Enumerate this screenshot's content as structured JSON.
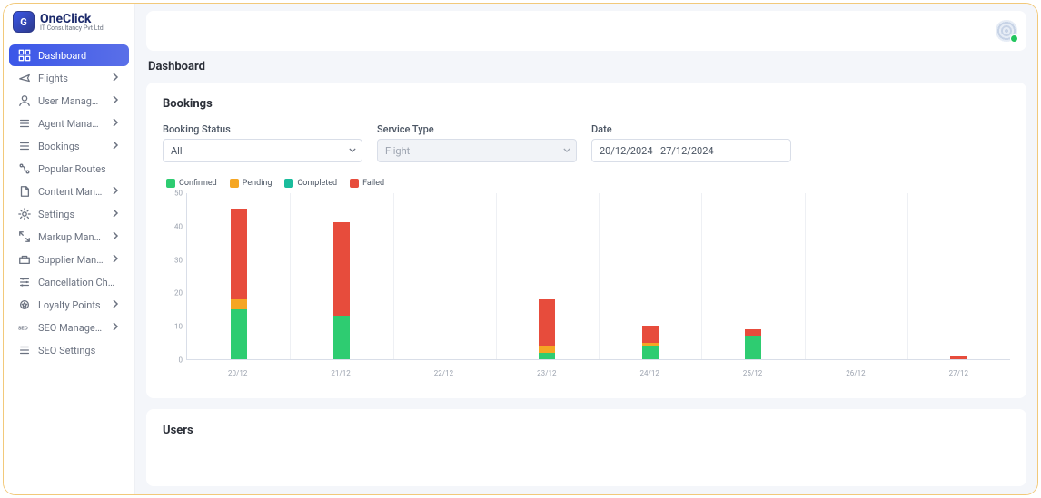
{
  "brand": {
    "title": "OneClick",
    "subtitle": "IT Consultancy Pvt Ltd"
  },
  "sidebar": {
    "items": [
      {
        "icon": "dashboard",
        "label": "Dashboard",
        "chevron": false,
        "active": true
      },
      {
        "icon": "plane",
        "label": "Flights",
        "chevron": true
      },
      {
        "icon": "user",
        "label": "User Management",
        "chevron": true
      },
      {
        "icon": "list",
        "label": "Agent Managem...",
        "chevron": true
      },
      {
        "icon": "list",
        "label": "Bookings",
        "chevron": true
      },
      {
        "icon": "route",
        "label": "Popular Routes",
        "chevron": false
      },
      {
        "icon": "doc",
        "label": "Content Manage...",
        "chevron": true
      },
      {
        "icon": "gear",
        "label": "Settings",
        "chevron": true
      },
      {
        "icon": "expand",
        "label": "Markup Manage...",
        "chevron": true
      },
      {
        "icon": "supplier",
        "label": "Supplier Manage...",
        "chevron": true
      },
      {
        "icon": "sliders",
        "label": "Cancellation Char...",
        "chevron": false
      },
      {
        "icon": "loyalty",
        "label": "Loyalty Points",
        "chevron": true
      },
      {
        "icon": "seo",
        "label": "SEO Management",
        "chevron": true
      },
      {
        "icon": "list",
        "label": "SEO Settings",
        "chevron": false
      }
    ]
  },
  "page": {
    "title": "Dashboard"
  },
  "bookings_card": {
    "title": "Bookings",
    "filters": {
      "status": {
        "label": "Booking Status",
        "value": "All"
      },
      "service": {
        "label": "Service Type",
        "value": "Flight",
        "disabled": true
      },
      "date": {
        "label": "Date",
        "value": "20/12/2024 - 27/12/2024"
      }
    },
    "legend": [
      {
        "name": "Confirmed",
        "color": "#2ecc71"
      },
      {
        "name": "Pending",
        "color": "#f5a623"
      },
      {
        "name": "Completed",
        "color": "#1abc9c"
      },
      {
        "name": "Failed",
        "color": "#e74c3c"
      }
    ]
  },
  "users_card": {
    "title": "Users"
  },
  "chart_data": {
    "type": "bar",
    "title": "",
    "xlabel": "",
    "ylabel": "",
    "ylim": [
      0,
      50
    ],
    "yticks": [
      0,
      10,
      20,
      30,
      40,
      50
    ],
    "categories": [
      "20/12",
      "21/12",
      "22/12",
      "23/12",
      "24/12",
      "25/12",
      "26/12",
      "27/12"
    ],
    "series": [
      {
        "name": "Confirmed",
        "color": "#2ecc71",
        "values": [
          15,
          13,
          0,
          2,
          4,
          7,
          0,
          0
        ]
      },
      {
        "name": "Pending",
        "color": "#f5a623",
        "values": [
          3,
          0,
          0,
          2,
          1,
          0,
          0,
          0
        ]
      },
      {
        "name": "Completed",
        "color": "#1abc9c",
        "values": [
          0,
          0,
          0,
          0,
          0,
          0,
          0,
          0
        ]
      },
      {
        "name": "Failed",
        "color": "#e74c3c",
        "values": [
          27,
          28,
          0,
          14,
          5,
          2,
          0,
          1
        ]
      }
    ]
  }
}
